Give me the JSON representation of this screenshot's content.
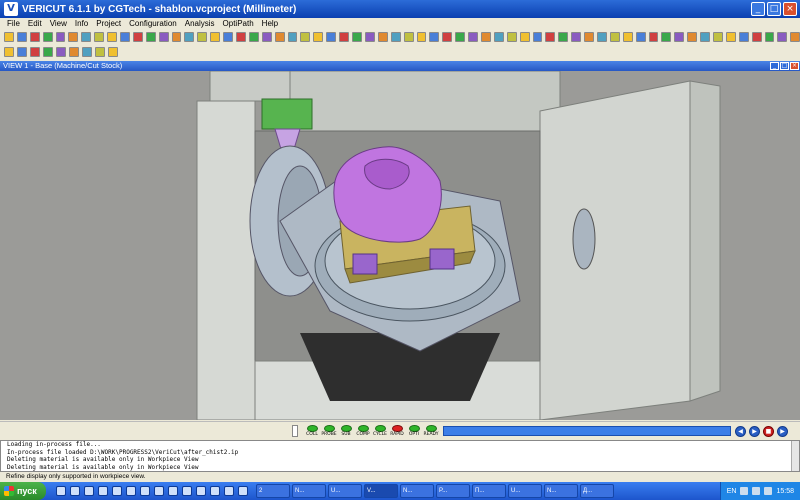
{
  "window": {
    "title": "VERICUT 6.1.1 by CGTech - shablon.vcproject (Millimeter)",
    "app_icon": "V",
    "minimize": "_",
    "maximize": "□",
    "close": "×"
  },
  "menu": {
    "items": [
      "File",
      "Edit",
      "View",
      "Info",
      "Project",
      "Configuration",
      "Analysis",
      "OptiPath",
      "Help"
    ]
  },
  "view": {
    "title": "VIEW 1 - Base (Machine/Cut Stock)"
  },
  "animation": {
    "leds": [
      {
        "label": "COLL",
        "state": "green"
      },
      {
        "label": "PROBE",
        "state": "green"
      },
      {
        "label": "SUB",
        "state": "green"
      },
      {
        "label": "COMP",
        "state": "green"
      },
      {
        "label": "CYCLE",
        "state": "green"
      },
      {
        "label": "RAPID",
        "state": "red"
      },
      {
        "label": "OPTI",
        "state": "green"
      },
      {
        "label": "READY",
        "state": "green"
      }
    ],
    "progress_fraction": 1.0,
    "buttons": [
      "rewind",
      "step",
      "stop",
      "play"
    ]
  },
  "log": {
    "lines": [
      "Loading in-process file...",
      "In-process file loaded D:\\WORK\\PROGRESS2\\VeriCut\\after_chist2.ip",
      "Deleting material is available only in Workpiece View",
      "Deleting material is available only in Workpiece View"
    ]
  },
  "status": {
    "text": "Refine display only supported in workpiece view."
  },
  "taskbar": {
    "start_label": "пуск",
    "tasks": [
      {
        "label": "2",
        "active": false
      },
      {
        "label": "N...",
        "active": false
      },
      {
        "label": "U...",
        "active": false
      },
      {
        "label": "V...",
        "active": true
      },
      {
        "label": "N...",
        "active": false
      },
      {
        "label": "P...",
        "active": false
      },
      {
        "label": "П...",
        "active": false
      },
      {
        "label": "U...",
        "active": false
      },
      {
        "label": "N...",
        "active": false
      },
      {
        "label": "Д...",
        "active": false
      }
    ],
    "lang": "EN",
    "clock": "15:58"
  },
  "colors": {
    "title_bar": "#0a3fb0",
    "machine_panel": "#d9dcd8",
    "rotary_table": "#a9b6c4",
    "workpiece": "#c075e0",
    "fixture": "#c9b460",
    "clamp": "#9966cc",
    "spindle": "#57b44f",
    "background": "#9b9b98"
  }
}
